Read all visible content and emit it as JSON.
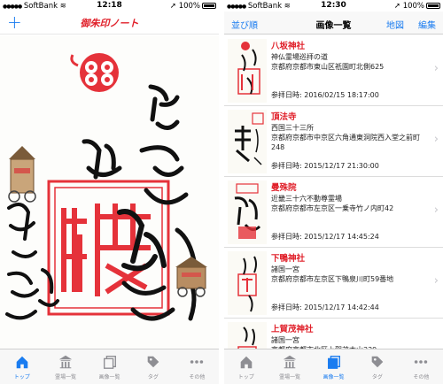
{
  "colors": {
    "accent": "#1a7cf0",
    "stamp_red": "#e0202a",
    "ink": "#111111",
    "inactive": "#8e8e93"
  },
  "left_screen": {
    "status": {
      "carrier": "SoftBank",
      "time": "12:18",
      "battery": "100%"
    },
    "nav": {
      "add_icon": "+",
      "title": "御朱印ノート"
    },
    "tabs": [
      {
        "label": "トップ",
        "icon": "house-icon",
        "active": true
      },
      {
        "label": "霊場一覧",
        "icon": "temple-icon",
        "active": false
      },
      {
        "label": "画像一覧",
        "icon": "images-icon",
        "active": false
      },
      {
        "label": "タグ",
        "icon": "tag-icon",
        "active": false
      },
      {
        "label": "その他",
        "icon": "more-icon",
        "active": false
      }
    ]
  },
  "right_screen": {
    "status": {
      "carrier": "SoftBank",
      "time": "12:30",
      "battery": "100%"
    },
    "nav": {
      "sort_label": "並び順",
      "title": "画像一覧",
      "map_label": "地図",
      "edit_label": "編集"
    },
    "items": [
      {
        "name": "八坂神社",
        "desc": "神仏霊場巡拝の道\n京都府京都市東山区祇園町北側625",
        "date": "参拝日時: 2016/02/15 18:17:00"
      },
      {
        "name": "頂法寺",
        "desc": "西国三十三所\n京都府京都市中京区六角通東洞院西入堂之前町248",
        "date": "参拝日時: 2015/12/17 21:30:00"
      },
      {
        "name": "曼殊院",
        "desc": "近畿三十六不動尊霊場\n京都府京都市左京区一乗寺竹ノ内町42",
        "date": "参拝日時: 2015/12/17 14:45:24"
      },
      {
        "name": "下鴨神社",
        "desc": "諸国一宮\n京都府京都市左京区下鴨泉川町59番地",
        "date": "参拝日時: 2015/12/17 14:42:44"
      },
      {
        "name": "上賀茂神社",
        "desc": "諸国一宮\n京都府京都市北区上賀茂本山339",
        "date": ""
      }
    ],
    "tabs": [
      {
        "label": "トップ",
        "icon": "house-icon",
        "active": false
      },
      {
        "label": "霊場一覧",
        "icon": "temple-icon",
        "active": false
      },
      {
        "label": "画像一覧",
        "icon": "images-icon",
        "active": true
      },
      {
        "label": "タグ",
        "icon": "tag-icon",
        "active": false
      },
      {
        "label": "その他",
        "icon": "more-icon",
        "active": false
      }
    ]
  }
}
